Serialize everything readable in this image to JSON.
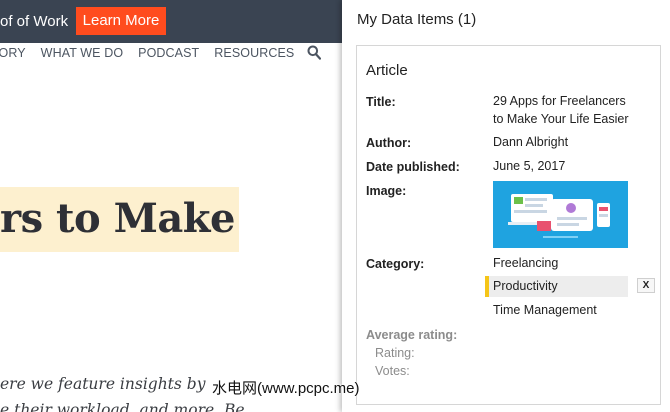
{
  "site": {
    "tagline": "of of Work",
    "learn_more": "Learn More",
    "nav": [
      "TORY",
      "WHAT WE DO",
      "PODCAST",
      "RESOURCES"
    ],
    "headline": "rs to Make",
    "excerpt_line1": "ere we feature insights by",
    "excerpt_line2": "e their workload, and more. Be",
    "watermark": "水电网(www.pcpc.me)"
  },
  "panel": {
    "title": "My Data Items (1)",
    "card": {
      "type": "Article",
      "fields": {
        "title_label": "Title:",
        "title_value": "29 Apps for Freelancers to Make Your Life Easier",
        "author_label": "Author:",
        "author_value": "Dann Albright",
        "date_label": "Date published:",
        "date_value": "June 5, 2017",
        "image_label": "Image:",
        "category_label": "Category:",
        "categories": [
          "Freelancing",
          "Productivity",
          "Time Management"
        ],
        "selected_category": "Productivity",
        "remove_label": "X",
        "avg_rating_label": "Average rating:",
        "rating_label": "Rating:",
        "votes_label": "Votes:"
      }
    }
  },
  "colors": {
    "topbar": "#3a4452",
    "learn_more_bg": "#ff4c1e",
    "headline_highlight": "#fdf0cf",
    "image_bg": "#1fa3e0",
    "category_accent": "#f5c518"
  }
}
